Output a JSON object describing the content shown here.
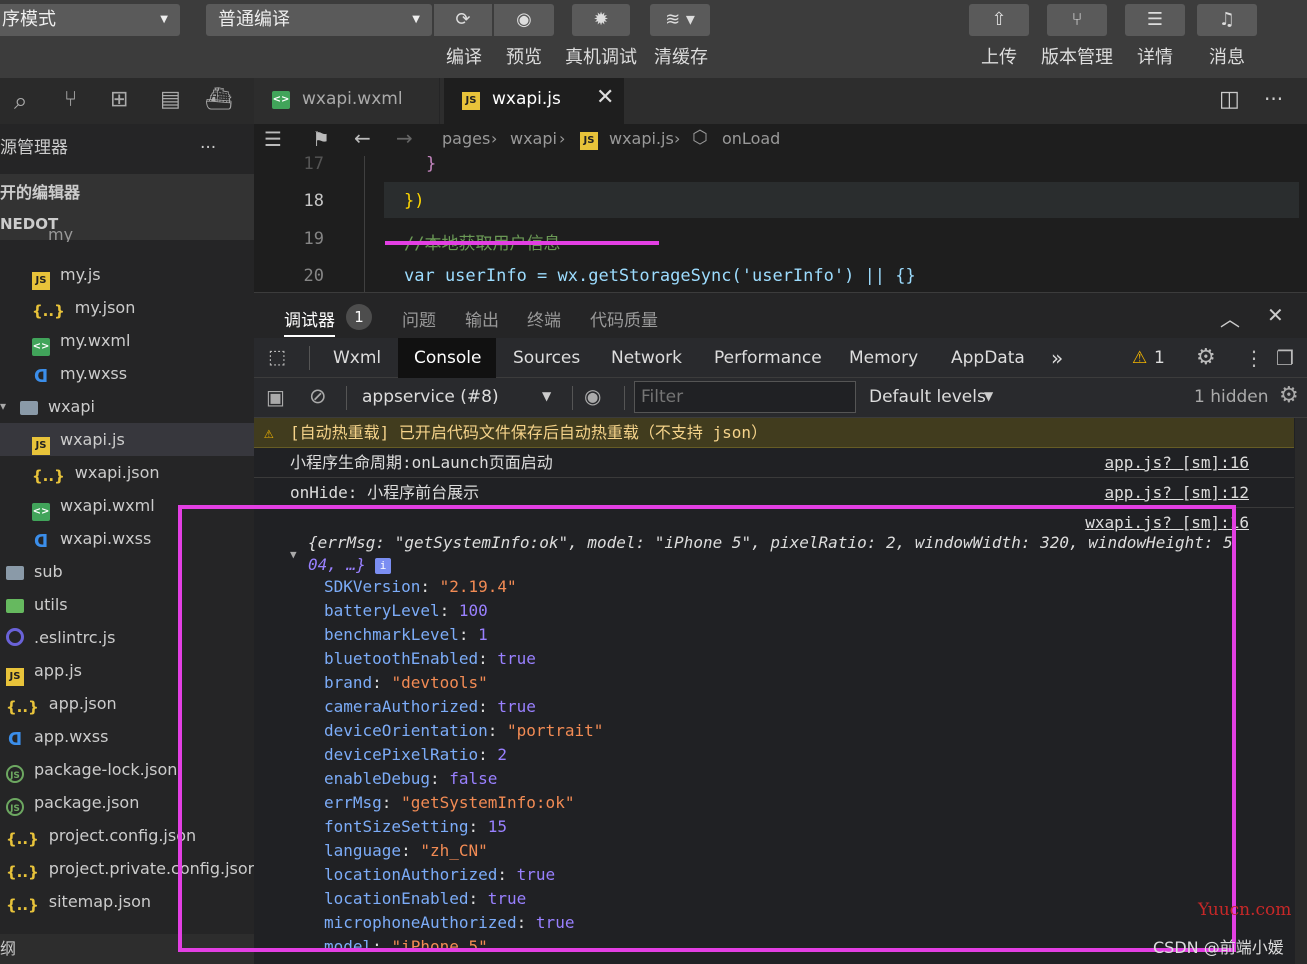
{
  "toolbar": {
    "mode_select": "序模式",
    "compile_select": "普通编译",
    "compile_label": "编译",
    "preview_label": "预览",
    "real_debug_label": "真机调试",
    "clear_cache_label": "清缓存",
    "upload_label": "上传",
    "version_label": "版本管理",
    "details_label": "详情",
    "messages_label": "消息"
  },
  "sidebar": {
    "title": "源管理器",
    "more": "···",
    "open_editors": "开的编辑器",
    "project": "NEDOT",
    "folder_my": "my",
    "items": [
      {
        "name": "my.js",
        "type": "js"
      },
      {
        "name": "my.json",
        "type": "json"
      },
      {
        "name": "my.wxml",
        "type": "wxml"
      },
      {
        "name": "my.wxss",
        "type": "wxss"
      },
      {
        "name": "wxapi",
        "type": "folder-open"
      },
      {
        "name": "wxapi.js",
        "type": "js"
      },
      {
        "name": "wxapi.json",
        "type": "json"
      },
      {
        "name": "wxapi.wxml",
        "type": "wxml"
      },
      {
        "name": "wxapi.wxss",
        "type": "wxss"
      },
      {
        "name": "sub",
        "type": "folder"
      },
      {
        "name": "utils",
        "type": "utils"
      },
      {
        "name": ".eslintrc.js",
        "type": "eslint"
      },
      {
        "name": "app.js",
        "type": "js"
      },
      {
        "name": "app.json",
        "type": "json"
      },
      {
        "name": "app.wxss",
        "type": "wxss"
      },
      {
        "name": "package-lock.json",
        "type": "node"
      },
      {
        "name": "package.json",
        "type": "node"
      },
      {
        "name": "project.config.json",
        "type": "json"
      },
      {
        "name": "project.private.config.json",
        "type": "json"
      },
      {
        "name": "sitemap.json",
        "type": "json"
      }
    ],
    "outline": "纲"
  },
  "editor": {
    "tabs": [
      {
        "label": "wxapi.wxml"
      },
      {
        "label": "wxapi.js"
      }
    ],
    "breadcrumb": [
      "pages",
      "wxapi",
      "wxapi.js",
      "onLoad"
    ],
    "lines": [
      {
        "num": "17",
        "text": "}"
      },
      {
        "num": "18",
        "text": "})"
      },
      {
        "num": "19",
        "text": "//本地获取用户信息"
      },
      {
        "num": "20",
        "text": "var userInfo = wx.getStorageSync('userInfo') || {}"
      }
    ]
  },
  "panel": {
    "tabs": [
      "调试器",
      "问题",
      "输出",
      "终端",
      "代码质量"
    ],
    "debugger_badge": "1",
    "devtools_tabs": [
      "Wxml",
      "Console",
      "Sources",
      "Network",
      "Performance",
      "Memory",
      "AppData"
    ],
    "more_tabs": "»",
    "warn_count": "1",
    "context": "appservice (#8)",
    "filter_placeholder": "Filter",
    "levels": "Default levels",
    "hidden": "1 hidden"
  },
  "console": {
    "warning": "[自动热重载] 已开启代码文件保存后自动热重载（不支持 json）",
    "logs": [
      {
        "text": "小程序生命周期:onLaunch页面启动",
        "src": "app.js? [sm]:16"
      },
      {
        "text": "onHide: 小程序前台展示",
        "src": "app.js? [sm]:12"
      }
    ],
    "object_src": "wxapi.js? [sm]:16",
    "object_summary_1": "{errMsg: \"getSystemInfo:ok\", model: \"iPhone 5\", pixelRatio: 2, windowWidth: 320, windowHeight: 5",
    "object_summary_2": "04, …}",
    "info_badge": "i",
    "props": [
      {
        "k": "SDKVersion",
        "v": "\"2.19.4\"",
        "t": "s"
      },
      {
        "k": "batteryLevel",
        "v": "100",
        "t": "n"
      },
      {
        "k": "benchmarkLevel",
        "v": "1",
        "t": "n"
      },
      {
        "k": "bluetoothEnabled",
        "v": "true",
        "t": "b"
      },
      {
        "k": "brand",
        "v": "\"devtools\"",
        "t": "s"
      },
      {
        "k": "cameraAuthorized",
        "v": "true",
        "t": "b"
      },
      {
        "k": "deviceOrientation",
        "v": "\"portrait\"",
        "t": "s"
      },
      {
        "k": "devicePixelRatio",
        "v": "2",
        "t": "n"
      },
      {
        "k": "enableDebug",
        "v": "false",
        "t": "b"
      },
      {
        "k": "errMsg",
        "v": "\"getSystemInfo:ok\"",
        "t": "s"
      },
      {
        "k": "fontSizeSetting",
        "v": "15",
        "t": "n"
      },
      {
        "k": "language",
        "v": "\"zh_CN\"",
        "t": "s"
      },
      {
        "k": "locationAuthorized",
        "v": "true",
        "t": "b"
      },
      {
        "k": "locationEnabled",
        "v": "true",
        "t": "b"
      },
      {
        "k": "microphoneAuthorized",
        "v": "true",
        "t": "b"
      },
      {
        "k": "model",
        "v": "\"iPhone 5\"",
        "t": "s"
      }
    ]
  },
  "watermark": {
    "site": "Yuucn.com",
    "author": "CSDN @前端小媛"
  },
  "colors": {
    "highlight": "#e33fe3",
    "accent": "#0e639c"
  }
}
